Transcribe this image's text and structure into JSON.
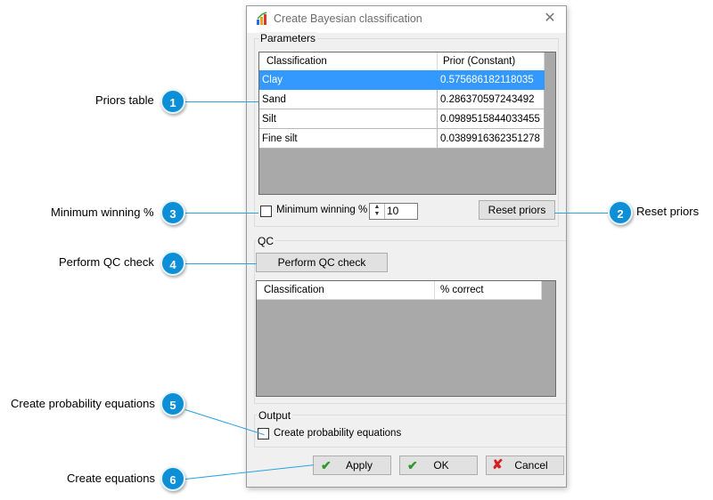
{
  "dialog": {
    "title": "Create Bayesian classification",
    "parameters_label": "Parameters",
    "priors_table": {
      "columns": [
        "Classification",
        "Prior (Constant)"
      ],
      "rows": [
        [
          "Clay",
          "0.575686182118035"
        ],
        [
          "Sand",
          "0.286370597243492"
        ],
        [
          "Silt",
          "0.0989515844033455"
        ],
        [
          "Fine silt",
          "0.0389916362351278"
        ]
      ],
      "selected_row": 0
    },
    "min_winning_label": "Minimum winning %",
    "min_winning_value": "10",
    "reset_priors_label": "Reset priors",
    "qc_label": "QC",
    "perform_qc_label": "Perform QC check",
    "qc_table": {
      "columns": [
        "Classification",
        "% correct"
      ]
    },
    "output_label": "Output",
    "create_prob_label": "Create probability equations",
    "apply_label": "Apply",
    "ok_label": "OK",
    "cancel_label": "Cancel"
  },
  "callouts": [
    {
      "num": "1",
      "text": "Priors table"
    },
    {
      "num": "2",
      "text": "Reset priors"
    },
    {
      "num": "3",
      "text": "Minimum winning %"
    },
    {
      "num": "4",
      "text": "Perform QC check"
    },
    {
      "num": "5",
      "text": "Create probability equations"
    },
    {
      "num": "6",
      "text": "Create equations"
    }
  ],
  "colors": {
    "accent": "#0d8fd8",
    "selection": "#3399ff",
    "callout_line": "#29a3e0"
  }
}
